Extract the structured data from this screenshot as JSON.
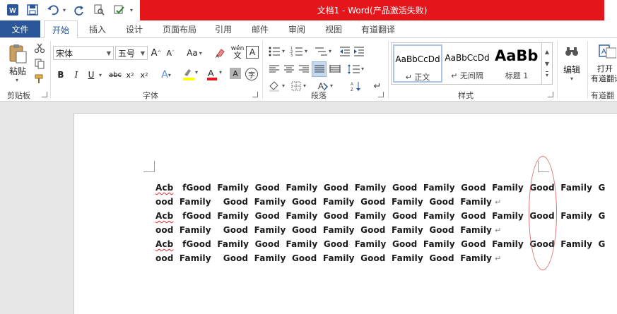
{
  "window": {
    "title": "文档1 - Word(产品激活失败)"
  },
  "quick_access": {
    "word_icon": "word-logo-icon",
    "save": "save-icon",
    "undo": "undo-icon",
    "redo": "redo-icon",
    "print_preview": "print-preview-icon",
    "check": "spelling-check-icon"
  },
  "tabs": {
    "file": "文件",
    "items": [
      "开始",
      "插入",
      "设计",
      "页面布局",
      "引用",
      "邮件",
      "审阅",
      "视图",
      "有道翻译"
    ],
    "active": "开始"
  },
  "ribbon": {
    "clipboard": {
      "paste": "粘贴",
      "label": "剪贴板"
    },
    "font": {
      "family": "宋体",
      "size": "五号",
      "case_btn": "Aa",
      "pinyin": "wén",
      "label": "字体"
    },
    "paragraph": {
      "label": "段落"
    },
    "styles": {
      "items": [
        {
          "sample": "AaBbCcDd",
          "name": "↵ 正文"
        },
        {
          "sample": "AaBbCcDd",
          "name": "↵ 无间隔"
        },
        {
          "sample": "AaBb",
          "name": "标题 1"
        }
      ],
      "label": "样式"
    },
    "editing": {
      "label": "编辑"
    },
    "youdao": {
      "open": "打开",
      "name": "有道翻译",
      "label": "有道翻"
    }
  },
  "document": {
    "lines": [
      {
        "spell": "Acb",
        "text": "   fGood  Family  Good  Family  Good  Family  Good  Family  Good  Family  Good  Family  G",
        "mark": false
      },
      {
        "spell": "",
        "text": "ood  Family    Good  Family  Good  Family  Good  Family  Good  Family",
        "mark": true
      },
      {
        "spell": "Acb",
        "text": "   fGood  Family  Good  Family  Good  Family  Good  Family  Good  Family  Good  Family  G",
        "mark": false
      },
      {
        "spell": "",
        "text": "ood  Family    Good  Family  Good  Family  Good  Family  Good  Family",
        "mark": true
      },
      {
        "spell": "Acb",
        "text": "   fGood  Family  Good  Family  Good  Family  Good  Family  Good  Family  Good  Family  G",
        "mark": false
      },
      {
        "spell": "",
        "text": "ood  Family    Good  Family  Good  Family  Good  Family  Good  Family",
        "mark": true
      }
    ],
    "paragraph_mark": "↵"
  },
  "colors": {
    "title_bar": "#e4161b",
    "file_tab": "#2b579a",
    "annotation": "#e07070"
  }
}
